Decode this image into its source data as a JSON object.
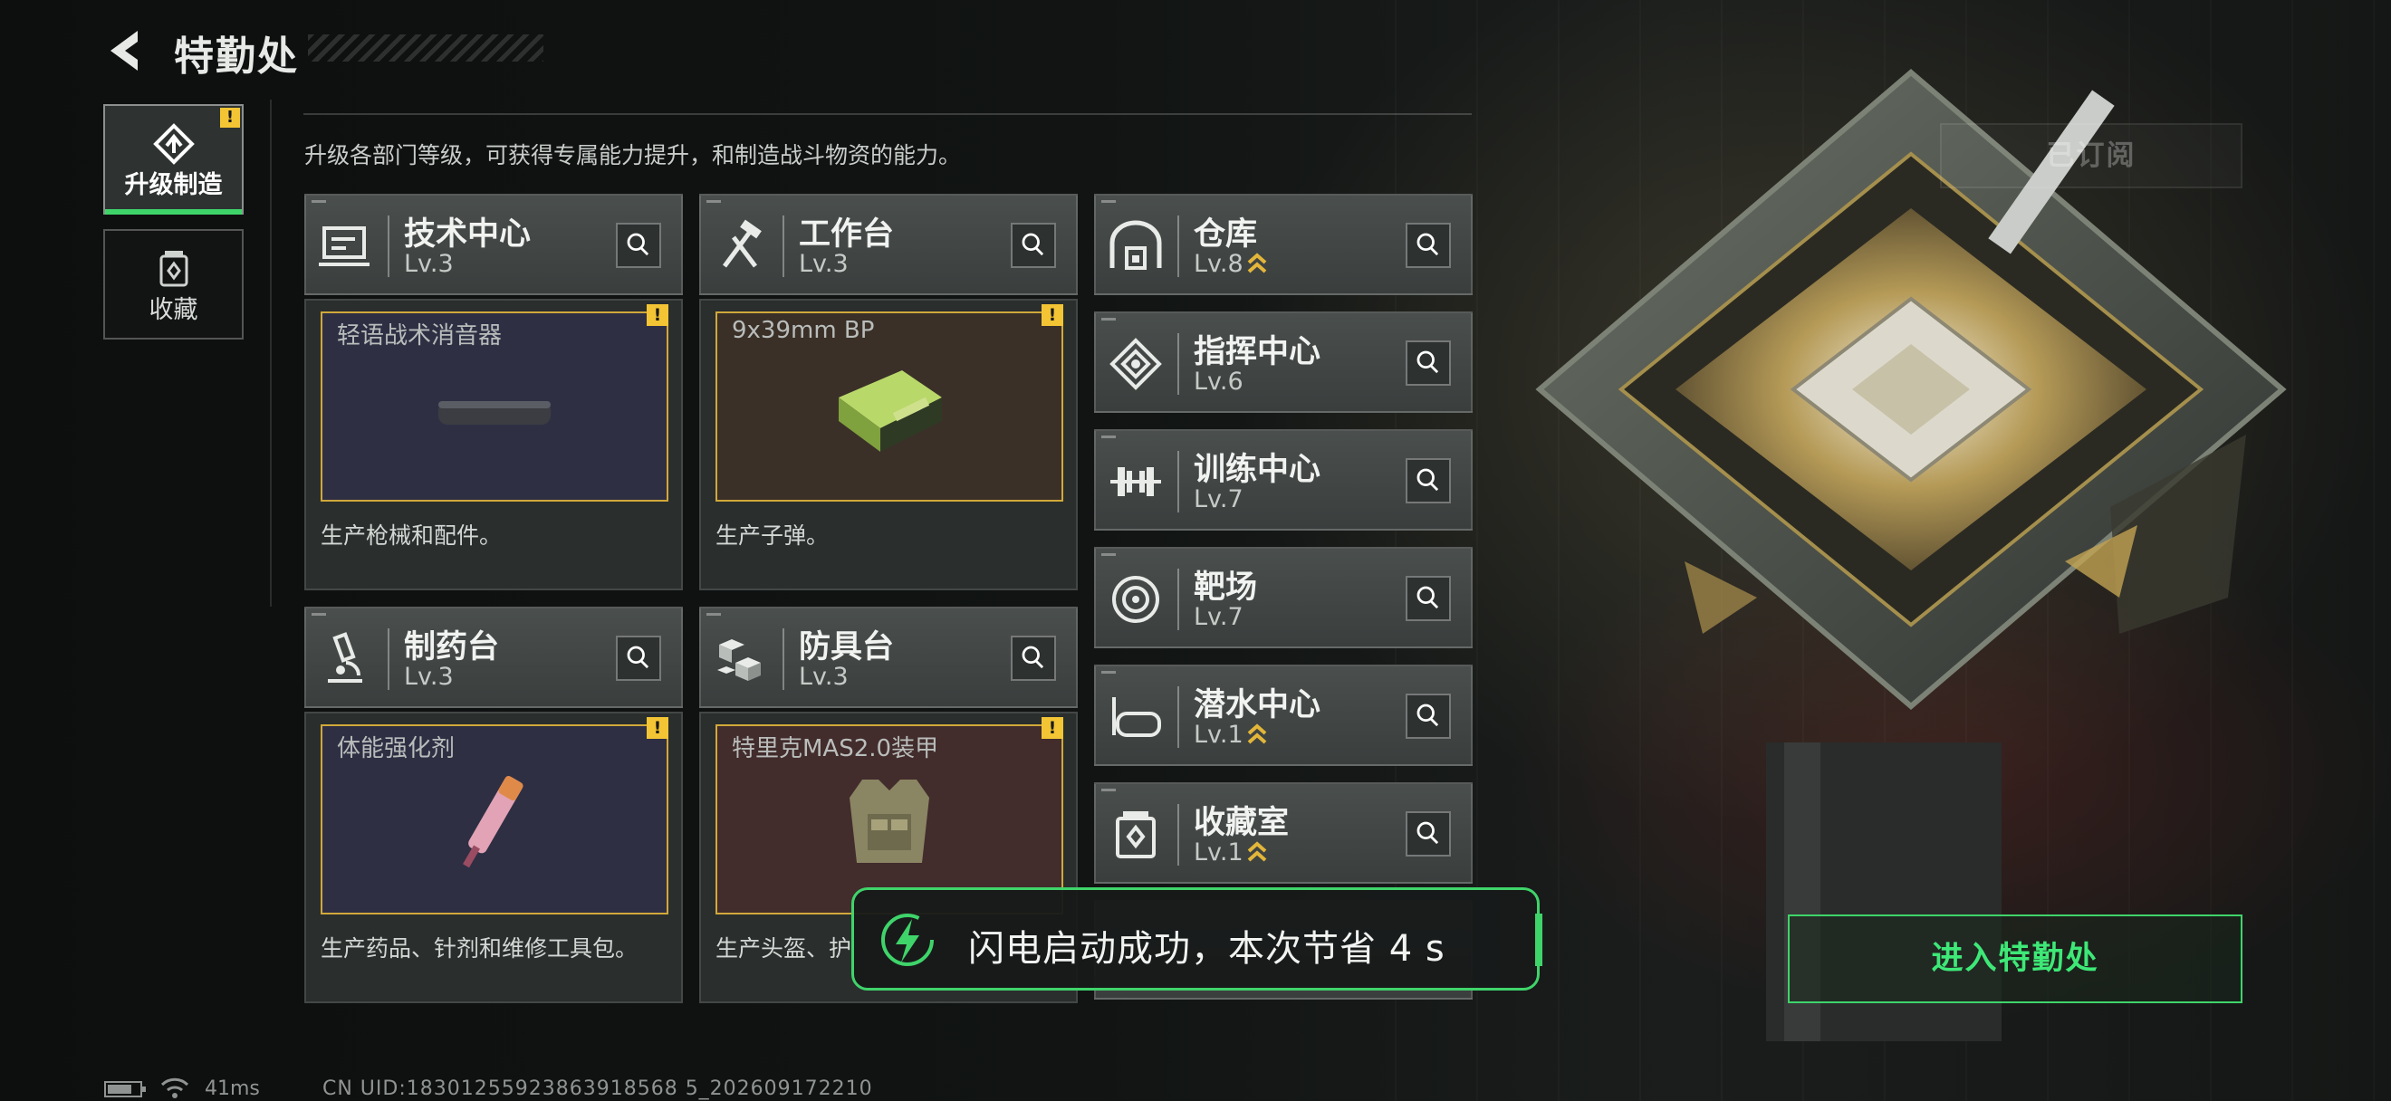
{
  "header": {
    "title": "特勤处"
  },
  "subtitle": "升级各部门等级，可获得专属能力提升，和制造战斗物资的能力。",
  "nav": [
    {
      "label": "升级制造",
      "active": true,
      "warn": "!"
    },
    {
      "label": "收藏",
      "active": false
    }
  ],
  "facilities_left": [
    {
      "name": "技术中心",
      "level": "Lv.3",
      "icon": "tech-center-icon"
    },
    {
      "name": "工作台",
      "level": "Lv.3",
      "icon": "workbench-icon"
    },
    {
      "name": "制药台",
      "level": "Lv.3",
      "icon": "pharmacy-icon"
    },
    {
      "name": "防具台",
      "level": "Lv.3",
      "icon": "armor-bench-icon"
    }
  ],
  "production": [
    {
      "item": "轻语战术消音器",
      "desc": "生产枪械和配件。",
      "warn": "!",
      "bg": "#2f2f44"
    },
    {
      "item": "9x39mm BP",
      "desc": "生产子弹。",
      "warn": "!",
      "bg": "#3a3028"
    },
    {
      "item": "体能强化剂",
      "desc": "生产药品、针剂和维修工具包。",
      "warn": "!",
      "bg": "#2f2f44"
    },
    {
      "item": "特里克MAS2.0装甲",
      "desc": "生产头盔、护",
      "warn": "!",
      "bg": "#422c2c"
    }
  ],
  "facilities_right": [
    {
      "name": "仓库",
      "level": "Lv.8",
      "upgrade": true,
      "icon": "warehouse-icon"
    },
    {
      "name": "指挥中心",
      "level": "Lv.6",
      "upgrade": false,
      "icon": "command-center-icon"
    },
    {
      "name": "训练中心",
      "level": "Lv.7",
      "upgrade": false,
      "icon": "training-center-icon"
    },
    {
      "name": "靶场",
      "level": "Lv.7",
      "upgrade": false,
      "icon": "shooting-range-icon"
    },
    {
      "name": "潜水中心",
      "level": "Lv.1",
      "upgrade": true,
      "icon": "diving-center-icon"
    },
    {
      "name": "收藏室",
      "level": "Lv.1",
      "upgrade": true,
      "icon": "collection-room-icon"
    }
  ],
  "subscribed_label": "已订阅",
  "enter_button": "进入特勤处",
  "toast": {
    "text": "闪电启动成功，本次节省 4 s"
  },
  "status": {
    "ping": "41ms",
    "uid": "CN UID:18301255923863918568 5_202609172210"
  },
  "colors": {
    "accent_green": "#3fd46a",
    "warn_yellow": "#f3c534",
    "slot_border": "#d1a93a"
  }
}
